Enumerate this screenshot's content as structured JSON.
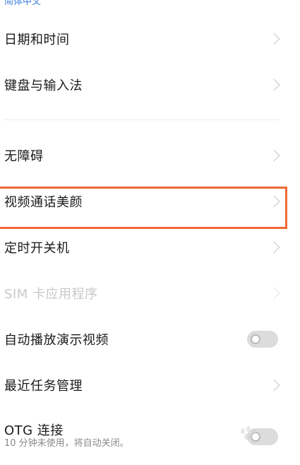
{
  "top_partial": "简体中文",
  "items": [
    {
      "label": "日期和时间",
      "control": "chevron"
    },
    {
      "label": "键盘与输入法",
      "control": "chevron"
    },
    {
      "label": "无障碍",
      "control": "chevron"
    },
    {
      "label": "视频通话美颜",
      "control": "chevron",
      "highlighted": true
    },
    {
      "label": "定时开关机",
      "control": "chevron"
    },
    {
      "label": "SIM 卡应用程序",
      "control": "chevron",
      "disabled": true
    },
    {
      "label": "自动播放演示视频",
      "control": "toggle",
      "toggle_on": false
    },
    {
      "label": "最近任务管理",
      "control": "chevron"
    },
    {
      "label": "OTG 连接",
      "sublabel": "10 分钟未使用，将自动关闭。",
      "control": "toggle",
      "toggle_on": false
    }
  ],
  "colors": {
    "highlight": "#ee6a34",
    "text": "#1a1a1a",
    "disabled_text": "#c8c8c8",
    "chevron": "#c6c6c6",
    "toggle_off": "#dcdcdc"
  },
  "icons": {
    "chevron": "chevron-right-icon",
    "toggle": "toggle-switch"
  }
}
